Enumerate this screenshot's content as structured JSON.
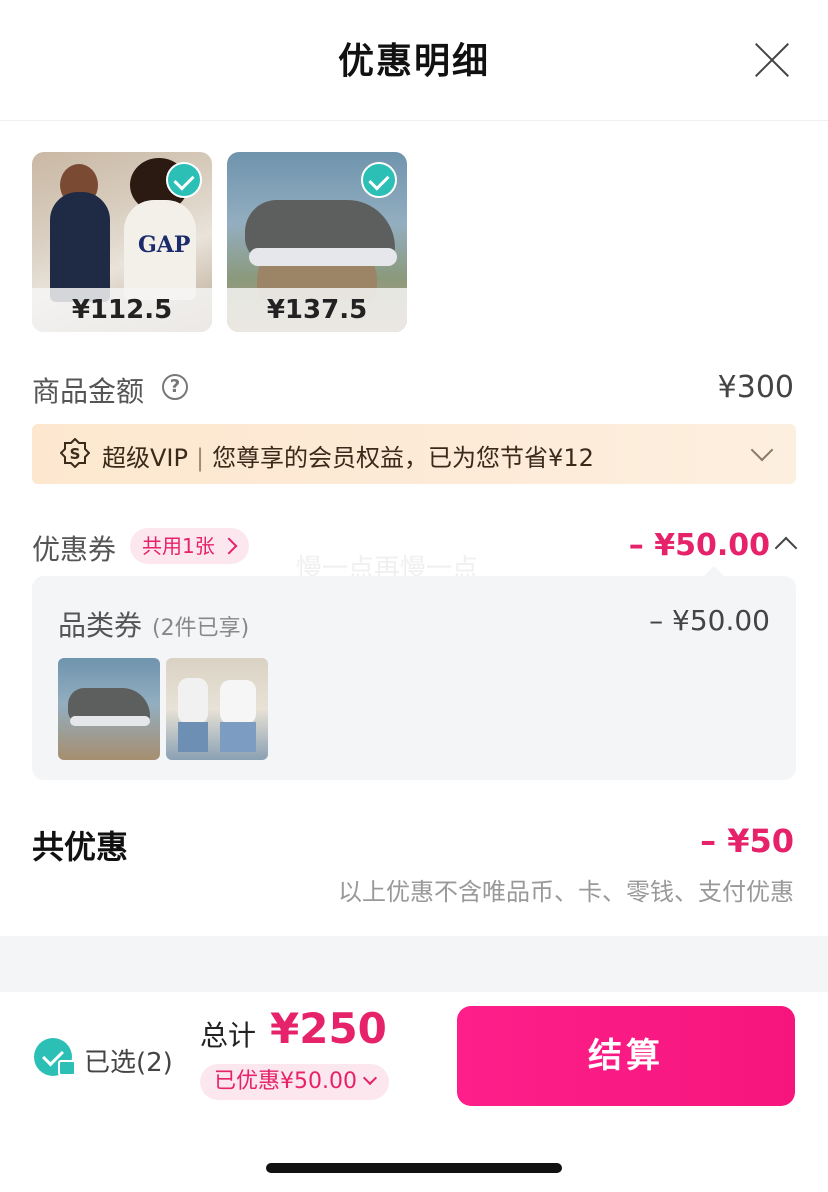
{
  "header": {
    "title": "优惠明细"
  },
  "products": [
    {
      "price": "¥112.5",
      "image": "couple-gap-tshirts"
    },
    {
      "price": "¥137.5",
      "image": "grey-hiking-shoe"
    }
  ],
  "amount": {
    "label": "商品金额",
    "value": "¥300"
  },
  "vip": {
    "badge": "超级VIP",
    "text": "您尊享的会员权益，已为您节省¥12"
  },
  "coupon": {
    "label": "优惠券",
    "tag": "共用1张",
    "value": "– ¥50.00",
    "watermark": "慢一点再慢一点",
    "category": {
      "label": "品类券",
      "sub": "(2件已享)",
      "value": "– ¥50.00"
    }
  },
  "summary": {
    "label": "共优惠",
    "value": "– ¥50",
    "note": "以上优惠不含唯品币、卡、零钱、支付优惠"
  },
  "footer": {
    "selected": "已选(2)",
    "total_label": "总计",
    "total_value": "¥250",
    "discount_pill": "已优惠¥50.00",
    "checkout": "结算"
  },
  "colors": {
    "accent": "#e5226a",
    "teal": "#2bbfb5",
    "vip_bg": "#fde7cf"
  }
}
